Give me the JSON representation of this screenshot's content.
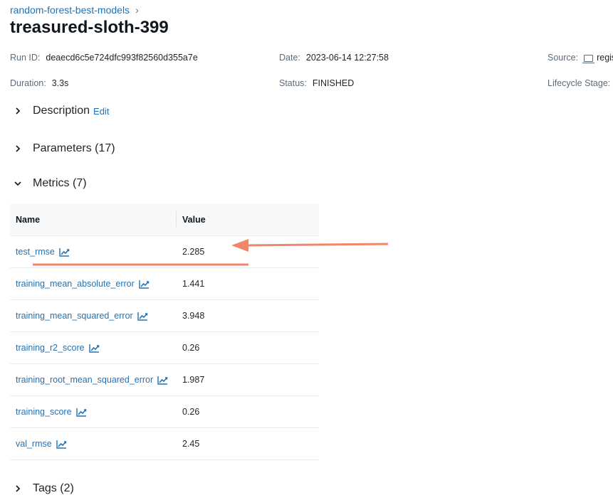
{
  "breadcrumb": {
    "label": "random-forest-best-models",
    "chevron": "chevron-right-icon"
  },
  "title": "treasured-sloth-399",
  "meta": {
    "run_id": {
      "label": "Run ID:",
      "value": "deaecd6c5e724dfc993f82560d355a7e"
    },
    "date": {
      "label": "Date:",
      "value": "2023-06-14 12:27:58"
    },
    "source": {
      "label": "Source:",
      "value": "regis",
      "icon": "monitor-icon"
    },
    "duration": {
      "label": "Duration:",
      "value": "3.3s"
    },
    "status": {
      "label": "Status:",
      "value": "FINISHED"
    },
    "lifecycle": {
      "label": "Lifecycle Stage:",
      "value": ""
    }
  },
  "sections": {
    "description": {
      "label": "Description",
      "edit": "Edit"
    },
    "parameters": {
      "label": "Parameters (17)"
    },
    "metrics": {
      "label": "Metrics (7)"
    },
    "tags": {
      "label": "Tags (2)"
    }
  },
  "metrics_table": {
    "headers": {
      "name": "Name",
      "value": "Value"
    },
    "rows": [
      {
        "name": "test_rmse",
        "value": "2.285"
      },
      {
        "name": "training_mean_absolute_error",
        "value": "1.441"
      },
      {
        "name": "training_mean_squared_error",
        "value": "3.948"
      },
      {
        "name": "training_r2_score",
        "value": "0.26"
      },
      {
        "name": "training_root_mean_squared_error",
        "value": "1.987"
      },
      {
        "name": "training_score",
        "value": "0.26"
      },
      {
        "name": "val_rmse",
        "value": "2.45"
      }
    ],
    "row_icon": "line-chart-icon"
  },
  "colors": {
    "link": "#2272b4",
    "annotation": "#f0866a"
  }
}
